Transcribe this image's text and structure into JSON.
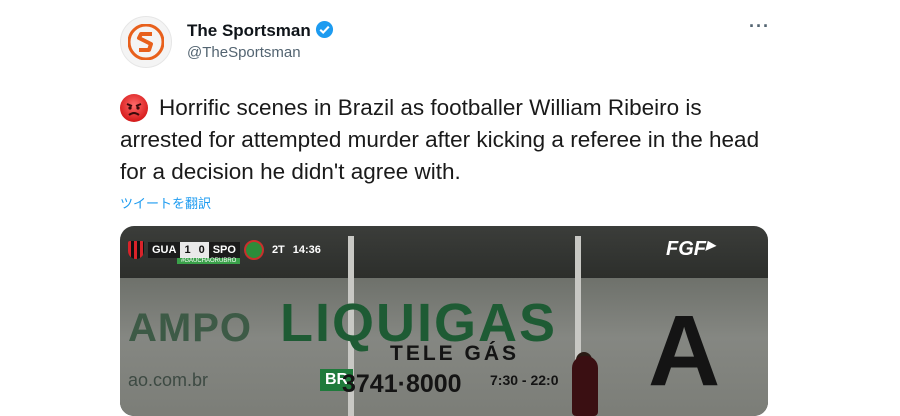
{
  "account": {
    "display_name": "The Sportsman",
    "handle": "@TheSportsman",
    "avatar": "sportsman-logo",
    "verified_icon": "verified-badge-icon",
    "more_label": "···"
  },
  "tweet": {
    "emoji_icon": "angry-face-emoji",
    "text": "Horrific scenes in Brazil as footballer William Ribeiro is arrested for attempted murder after kicking a referee in the head for a decision he didn't agree with.",
    "translate_label": "ツイートを翻訳"
  },
  "media": {
    "scoreboard": {
      "home": "GUA",
      "home_score": "1",
      "away_score": "0",
      "away": "SPO",
      "period": "2T",
      "clock": "14:36",
      "hashtag": "#GAUCHAORUBRO"
    },
    "broadcaster": "FGF",
    "sign_main": "LIQUIGAS",
    "sign_sub": "TELE GÁS",
    "sign_phone": "3741·8000",
    "sign_hours": "7:30 - 22:0",
    "sign_br": "BR",
    "sign_left": "AMPO",
    "sign_site": "ao.com.br",
    "sign_right": "A"
  },
  "colors": {
    "link": "#1d9bf0",
    "verified": "#1d9bf0",
    "brand": "#e8601c"
  }
}
